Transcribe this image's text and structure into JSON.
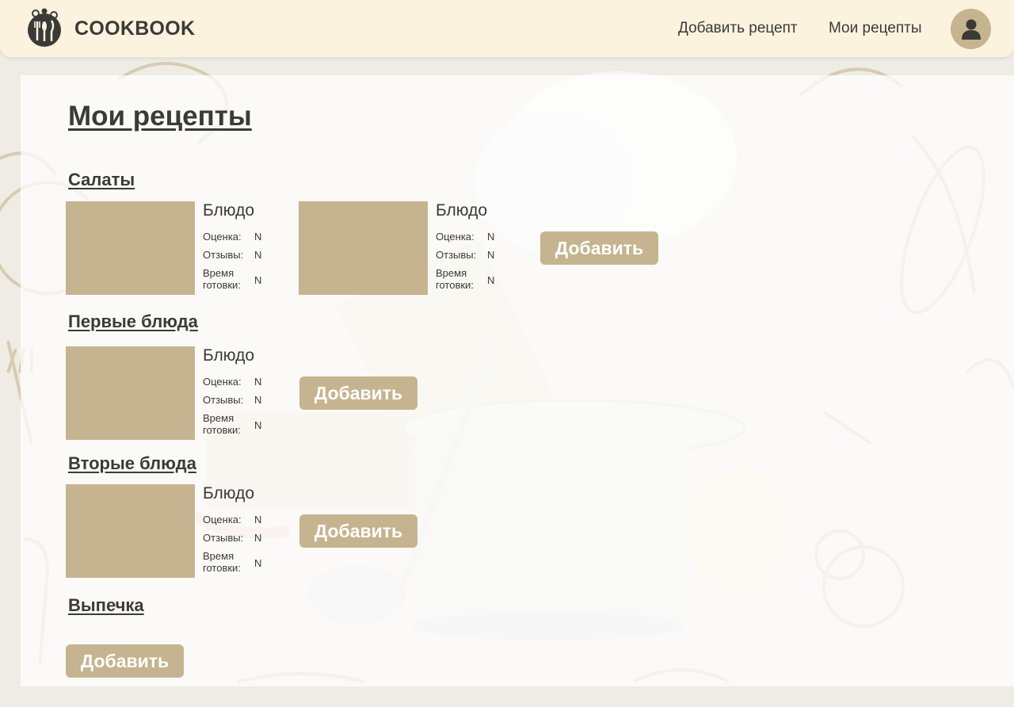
{
  "header": {
    "brand": "COOKBOOK",
    "logo_icon": "chef-utensils-logo",
    "nav": {
      "add_recipe": "Добавить рецепт",
      "my_recipes": "Мои рецепты"
    },
    "avatar_icon": "user-icon"
  },
  "page": {
    "title": "Мои рецепты"
  },
  "labels": {
    "dish": "Блюдо",
    "rating": "Оценка:",
    "reviews": "Отзывы:",
    "cook_time_line1": "Время",
    "cook_time_line2": "готовки:",
    "add_button": "Добавить"
  },
  "sections": [
    {
      "title": "Салаты",
      "recipes": [
        {
          "name": "Блюдо",
          "rating": "N",
          "reviews": "N",
          "cook_time": "N"
        },
        {
          "name": "Блюдо",
          "rating": "N",
          "reviews": "N",
          "cook_time": "N"
        }
      ],
      "add_label": "Добавить"
    },
    {
      "title": "Первые блюда",
      "recipes": [
        {
          "name": "Блюдо",
          "rating": "N",
          "reviews": "N",
          "cook_time": "N"
        }
      ],
      "add_label": "Добавить"
    },
    {
      "title": "Вторые блюда",
      "recipes": [
        {
          "name": "Блюдо",
          "rating": "N",
          "reviews": "N",
          "cook_time": "N"
        }
      ],
      "add_label": "Добавить"
    },
    {
      "title": "Выпечка",
      "recipes": [],
      "add_label": "Добавить"
    }
  ],
  "colors": {
    "header_bg": "#fbf3de",
    "accent": "#c5b48f",
    "text": "#3b3a36",
    "button_text": "#ffffff"
  }
}
